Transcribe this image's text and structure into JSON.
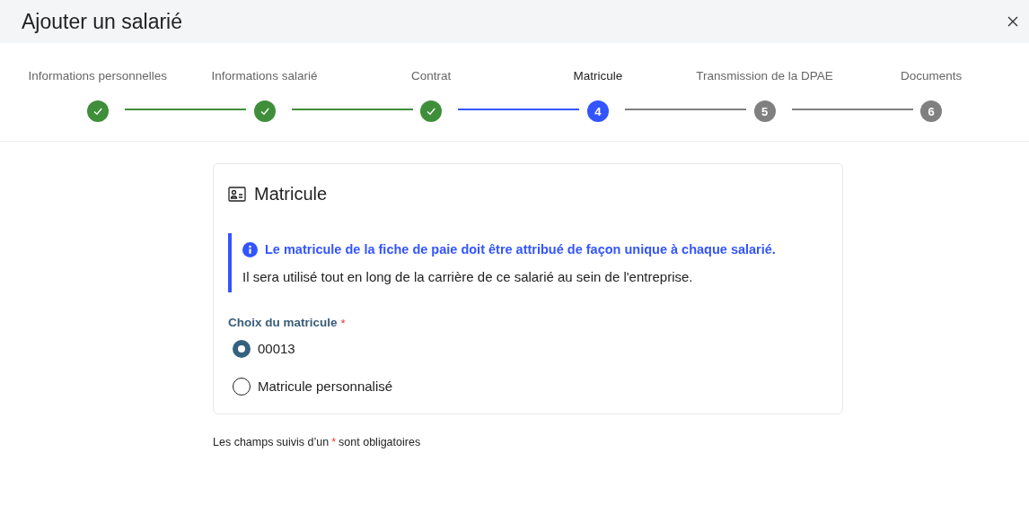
{
  "window": {
    "title": "Ajouter un salarié"
  },
  "steps": [
    {
      "label": "Informations personnelles",
      "completed": true,
      "current": false
    },
    {
      "label": "Informations salarié",
      "completed": true,
      "current": false
    },
    {
      "label": "Contrat",
      "completed": true,
      "current": false
    },
    {
      "label": "Matricule",
      "completed": false,
      "current": true,
      "number": "4"
    },
    {
      "label": "Transmission de la DPAE",
      "completed": false,
      "current": false,
      "number": "5"
    },
    {
      "label": "Documents",
      "completed": false,
      "current": false,
      "number": "6"
    }
  ],
  "card": {
    "title": "Matricule",
    "info": {
      "heading": "Le matricule de la fiche de paie doit être attribué de façon unique à chaque salarié.",
      "text": "Il sera utilisé tout en long de la carrière de ce salarié au sein de l'entreprise."
    },
    "field": {
      "label": "Choix du matricule",
      "required_mark": "*",
      "options": [
        {
          "label": "00013",
          "selected": true
        },
        {
          "label": "Matricule personnalisé",
          "selected": false
        }
      ]
    }
  },
  "footer_note": {
    "before": "Les champs suivis d’un",
    "mark": "*",
    "after": "sont obligatoires"
  }
}
